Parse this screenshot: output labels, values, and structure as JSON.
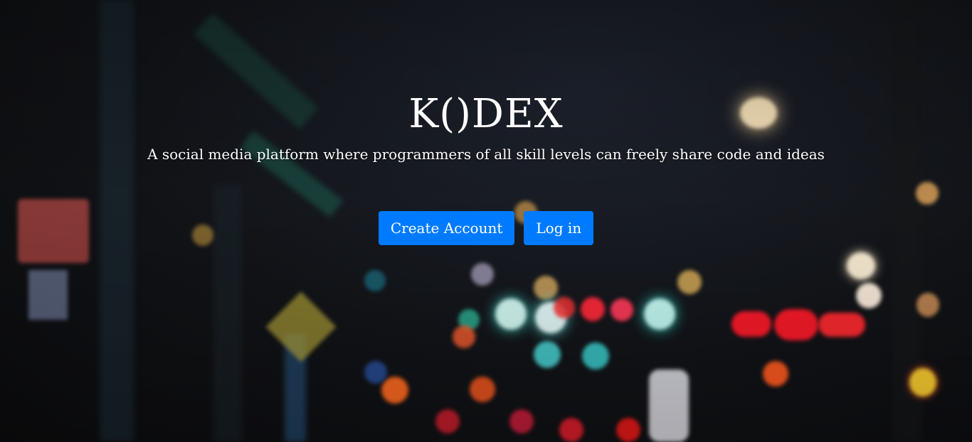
{
  "hero": {
    "brand": "K()DEX",
    "tagline": "A social media platform where programmers of all skill levels can freely share code and ideas"
  },
  "actions": {
    "create_account_label": "Create Account",
    "login_label": "Log in"
  },
  "colors": {
    "primary_button": "#007bff",
    "text": "#ffffff",
    "background": "#121418"
  },
  "background_image": "blurred night street with bokeh lights"
}
